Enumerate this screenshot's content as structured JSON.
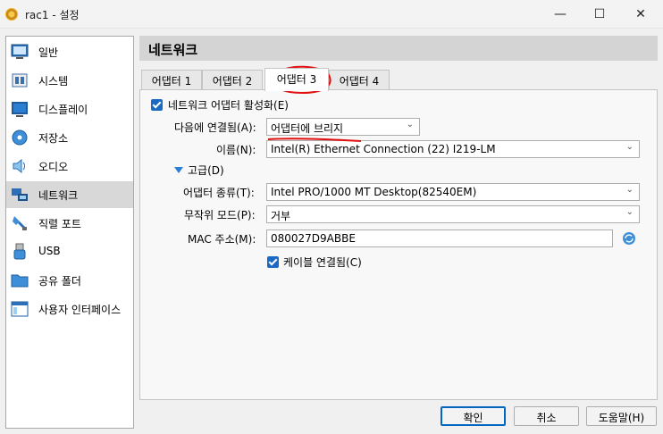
{
  "window": {
    "title": "rac1 - 설정",
    "minimize_glyph": "—",
    "maximize_glyph": "☐",
    "close_glyph": "✕"
  },
  "sidebar": {
    "items": [
      {
        "label": "일반",
        "icon": "monitor-icon"
      },
      {
        "label": "시스템",
        "icon": "chip-icon"
      },
      {
        "label": "디스플레이",
        "icon": "display-icon"
      },
      {
        "label": "저장소",
        "icon": "disk-icon"
      },
      {
        "label": "오디오",
        "icon": "speaker-icon"
      },
      {
        "label": "네트워크",
        "icon": "network-icon"
      },
      {
        "label": "직렬 포트",
        "icon": "serial-port-icon"
      },
      {
        "label": "USB",
        "icon": "usb-icon"
      },
      {
        "label": "공유 폴더",
        "icon": "folder-icon"
      },
      {
        "label": "사용자 인터페이스",
        "icon": "ui-icon"
      }
    ],
    "selected": "네트워크"
  },
  "main": {
    "title": "네트워크",
    "tabs": [
      {
        "label": "어댑터 1"
      },
      {
        "label": "어댑터 2"
      },
      {
        "label": "어댑터 3",
        "active": true
      },
      {
        "label": "어댑터 4"
      }
    ]
  },
  "adapter": {
    "enable_label": "네트워크 어댑터 활성화(E)",
    "enabled": true,
    "attached_label": "다음에 연결됨(A):",
    "attached_value": "어댑터에 브리지",
    "name_label": "이름(N):",
    "name_value": "Intel(R) Ethernet Connection (22) I219-LM",
    "advanced_label": "고급(D)",
    "type_label": "어댑터 종류(T):",
    "type_value": "Intel PRO/1000 MT Desktop(82540EM)",
    "promisc_label": "무작위 모드(P):",
    "promisc_value": "거부",
    "mac_label": "MAC 주소(M):",
    "mac_value": "080027D9ABBE",
    "cable_label": "케이블 연결됨(C)",
    "cable_connected": true
  },
  "buttons": {
    "ok": "확인",
    "cancel": "취소",
    "help": "도움말(H)"
  },
  "colors": {
    "accent": "#1b6bc4",
    "annotation_red": "#e01010",
    "selected_sidebar": "#d8d8d8"
  }
}
